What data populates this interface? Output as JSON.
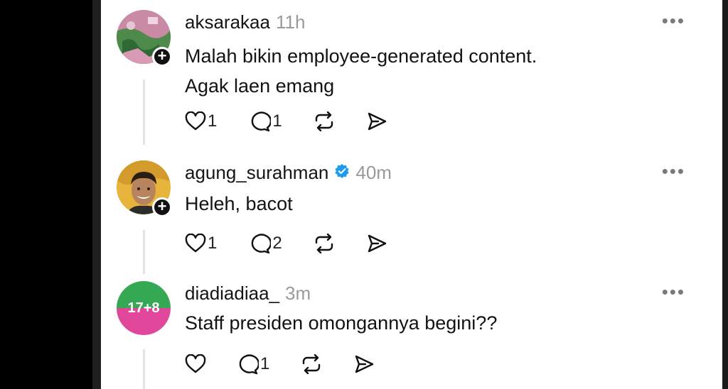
{
  "posts": [
    {
      "username": "aksarakaa",
      "time": "11h",
      "text_lines": [
        "Malah bikin employee-generated content.",
        "Agak laen emang"
      ],
      "likes": "1",
      "replies": "1",
      "verified": false,
      "avatar": "photo"
    },
    {
      "username": "agung_surahman",
      "time": "40m",
      "text_lines": [
        "Heleh, bacot"
      ],
      "likes": "1",
      "replies": "2",
      "verified": true,
      "avatar": "portrait"
    },
    {
      "username": "diadiadiaa_",
      "time": "3m",
      "text_lines": [
        "Staff presiden omongannya begini??"
      ],
      "likes": "",
      "replies": "1",
      "verified": false,
      "avatar_text": "17+8"
    }
  ],
  "icons": {
    "more": "more-icon",
    "like": "heart-icon",
    "reply": "comment-icon",
    "repost": "repost-icon",
    "share": "send-icon",
    "follow": "plus-icon",
    "verified": "verified-badge-icon"
  },
  "colors": {
    "verified_blue": "#1d9bf0",
    "timestamp_gray": "#9a9a9a",
    "avatar3_green": "#34a853",
    "avatar3_pink": "#e0479a"
  }
}
